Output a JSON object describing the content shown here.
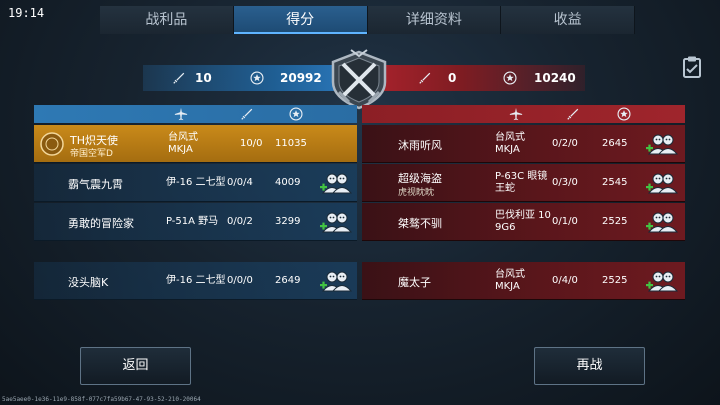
{
  "status": {
    "clock": "19:14"
  },
  "tabs": [
    {
      "label": "战利品"
    },
    {
      "label": "得分"
    },
    {
      "label": "详细资料"
    },
    {
      "label": "收益"
    }
  ],
  "active_tab": "得分",
  "summary": {
    "blue": {
      "kills": "10",
      "score": "20992"
    },
    "red": {
      "kills": "0",
      "score": "10240"
    }
  },
  "blue_team": [
    {
      "name": "TH炽天使",
      "sub": "帝国空军D",
      "plane_line1": "台风式",
      "plane_line2": "MKJA",
      "kd": "10/0",
      "score": "11035",
      "self": true
    },
    {
      "name": "霸气震九霄",
      "sub": "",
      "plane_line1": "伊-16 二七型",
      "plane_line2": "",
      "kd": "0/0/4",
      "score": "4009",
      "self": false
    },
    {
      "name": "勇敢的冒险家",
      "sub": "",
      "plane_line1": "P-51A 野马",
      "plane_line2": "",
      "kd": "0/0/2",
      "score": "3299",
      "self": false
    },
    {
      "name": "没头脑K",
      "sub": "",
      "plane_line1": "伊-16 二七型",
      "plane_line2": "",
      "kd": "0/0/0",
      "score": "2649",
      "self": false
    }
  ],
  "red_team": [
    {
      "name": "沐雨听风",
      "sub": "",
      "plane_line1": "台风式",
      "plane_line2": "MKJA",
      "kd": "0/2/0",
      "score": "2645"
    },
    {
      "name": "超级海盗",
      "sub": "虎视眈眈",
      "plane_line1": "P-63C 眼镜",
      "plane_line2": "王蛇",
      "kd": "0/3/0",
      "score": "2545"
    },
    {
      "name": "桀骜不驯",
      "sub": "",
      "plane_line1": "巴伐利亚 10",
      "plane_line2": "9G6",
      "kd": "0/1/0",
      "score": "2525"
    },
    {
      "name": "魔太子",
      "sub": "",
      "plane_line1": "台风式",
      "plane_line2": "MKJA",
      "kd": "0/4/0",
      "score": "2525"
    }
  ],
  "buttons": {
    "back": "返回",
    "replay": "再战"
  },
  "session_id": "5ae5aee0-1e36-11e9-858f-077c7fa59b67-47-93-52-210-20064",
  "colors": {
    "blue_team": "#2a6da4",
    "red_team": "#9f252c",
    "self_highlight": "#c98a1a"
  },
  "icons": [
    "plane-icon",
    "sword-icon",
    "star-medal-icon",
    "add-friend-icon",
    "rank-badge-icon",
    "clipboard-icon",
    "crossed-swords-emblem"
  ]
}
